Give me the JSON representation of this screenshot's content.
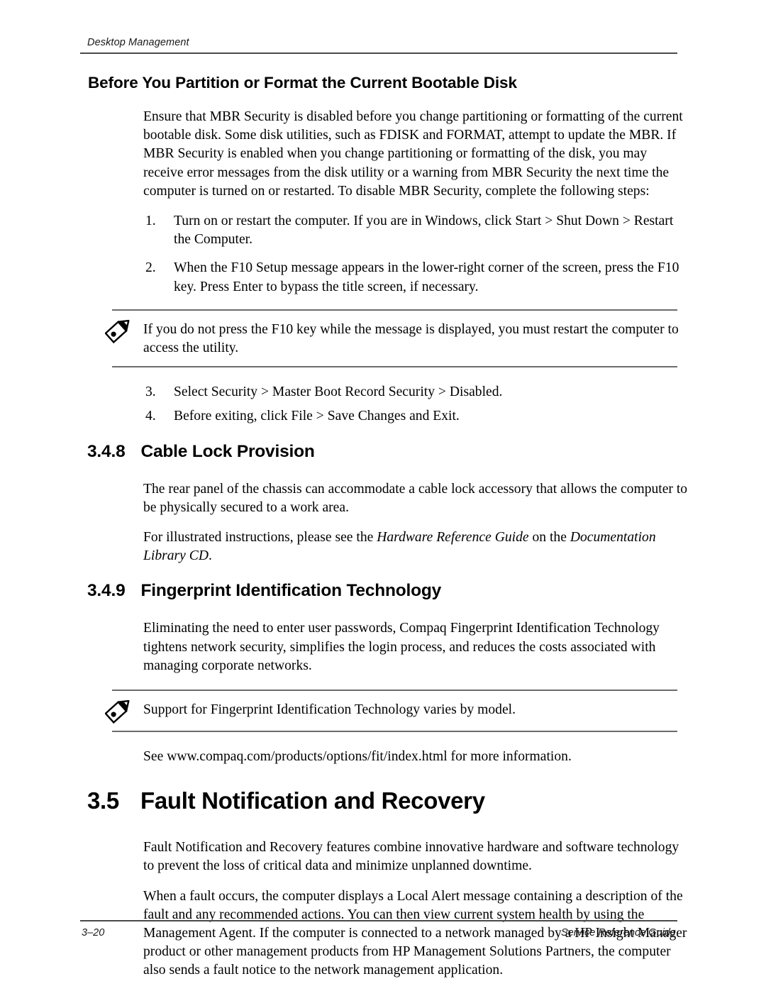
{
  "header": {
    "title": "Desktop Management"
  },
  "sections": {
    "bootable_disk": {
      "heading": "Before You Partition or Format the Current Bootable Disk",
      "intro": "Ensure that MBR Security is disabled before you change partitioning or formatting of the current bootable disk. Some disk utilities, such as FDISK and FORMAT, attempt to update the MBR. If MBR Security is enabled when you change partitioning or formatting of the disk, you may receive error messages from the disk utility or a warning from MBR Security the next time the computer is turned on or restarted. To disable MBR Security, complete the following steps:",
      "steps_part1": [
        {
          "marker": "1.",
          "text": "Turn on or restart the computer. If you are in Windows, click Start > Shut Down > Restart the Computer."
        },
        {
          "marker": "2.",
          "text": "When the F10 Setup message appears in the lower-right corner of the screen, press the F10 key. Press Enter to bypass the title screen, if necessary."
        }
      ],
      "note": "If you do not press the F10 key while the message is displayed, you must restart the computer to access the utility.",
      "steps_part2": [
        {
          "marker": "3.",
          "text": "Select Security > Master Boot Record Security > Disabled."
        },
        {
          "marker": "4.",
          "text": "Before exiting, click File > Save Changes and Exit."
        }
      ]
    },
    "cable_lock": {
      "number": "3.4.8",
      "title": "Cable Lock Provision",
      "para1": "The rear panel of the chassis can accommodate a cable lock accessory that allows the computer to be physically secured to a work area.",
      "para2_before": "For illustrated instructions, please see the ",
      "para2_italic1": "Hardware Reference Guide",
      "para2_middle": " on the ",
      "para2_italic2": "Documentation Library CD",
      "para2_after": "."
    },
    "fingerprint": {
      "number": "3.4.9",
      "title": "Fingerprint Identification Technology",
      "para1": "Eliminating the need to enter user passwords, Compaq Fingerprint Identification Technology tightens network security, simplifies the login process, and reduces the costs associated with managing corporate networks.",
      "note": "Support for Fingerprint Identification Technology varies by model.",
      "para2": "See www.compaq.com/products/options/fit/index.html for more information."
    },
    "fault": {
      "number": "3.5",
      "title": "Fault Notification and Recovery",
      "para1": "Fault Notification and Recovery features combine innovative hardware and software technology to prevent the loss of critical data and minimize unplanned downtime.",
      "para2": "When a fault occurs, the computer displays a Local Alert message containing a description of the fault and any recommended actions. You can then view current system health by using the Management Agent. If the computer is connected to a network managed by a HP Insight Manager product or other management products from HP Management Solutions Partners, the computer also sends a fault notice to the network management application."
    }
  },
  "icons": {
    "note_icon": "pencil-icon"
  },
  "footer": {
    "page_number": "3–20",
    "guide_title": "Service Reference Guide"
  },
  "colors": {
    "text": "#000000",
    "rule": "#4a4a4a",
    "note_rule": "#6b6b6b",
    "page_background": "#ffffff"
  }
}
